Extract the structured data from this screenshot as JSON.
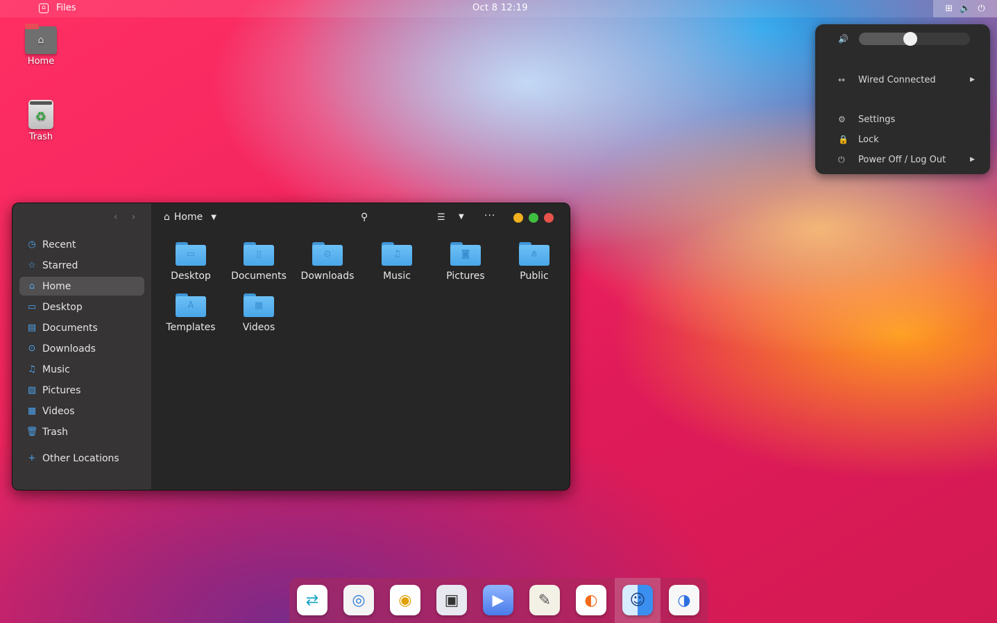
{
  "topbar": {
    "app_name": "Files",
    "clock": "Oct 8  12:19",
    "status_icons": [
      "network-icon",
      "volume-icon",
      "power-icon"
    ]
  },
  "desktop": {
    "icons": [
      {
        "label": "Home",
        "icon": "home-folder-icon"
      },
      {
        "label": "Trash",
        "icon": "trash-icon"
      }
    ]
  },
  "system_menu": {
    "volume_level": 0.46,
    "items": [
      {
        "label": "Wired Connected",
        "icon": "wired-icon",
        "has_submenu": true
      },
      {
        "label": "Settings",
        "icon": "settings-icon",
        "has_submenu": false
      },
      {
        "label": "Lock",
        "icon": "lock-icon",
        "has_submenu": false
      },
      {
        "label": "Power Off / Log Out",
        "icon": "power-icon",
        "has_submenu": true
      }
    ]
  },
  "files_window": {
    "location": "Home",
    "sidebar": [
      {
        "label": "Recent",
        "icon": "clock-icon"
      },
      {
        "label": "Starred",
        "icon": "star-icon"
      },
      {
        "label": "Home",
        "icon": "home-icon",
        "active": true
      },
      {
        "label": "Desktop",
        "icon": "desktop-icon"
      },
      {
        "label": "Documents",
        "icon": "documents-icon"
      },
      {
        "label": "Downloads",
        "icon": "downloads-icon"
      },
      {
        "label": "Music",
        "icon": "music-icon"
      },
      {
        "label": "Pictures",
        "icon": "pictures-icon"
      },
      {
        "label": "Videos",
        "icon": "videos-icon"
      },
      {
        "label": "Trash",
        "icon": "trash-icon"
      },
      {
        "label": "Other Locations",
        "icon": "plus-icon"
      }
    ],
    "folders": [
      {
        "label": "Desktop",
        "icon": "desktop-folder-icon"
      },
      {
        "label": "Documents",
        "icon": "documents-folder-icon"
      },
      {
        "label": "Downloads",
        "icon": "downloads-folder-icon"
      },
      {
        "label": "Music",
        "icon": "music-folder-icon"
      },
      {
        "label": "Pictures",
        "icon": "pictures-folder-icon"
      },
      {
        "label": "Public",
        "icon": "public-folder-icon"
      },
      {
        "label": "Templates",
        "icon": "templates-folder-icon"
      },
      {
        "label": "Videos",
        "icon": "videos-folder-icon"
      }
    ],
    "window_buttons": {
      "minimize": "#f2b01f",
      "maximize": "#3fbf3f",
      "close": "#e5534b"
    }
  },
  "dock": {
    "apps": [
      {
        "icon": "teamviewer-icon"
      },
      {
        "icon": "browser-icon"
      },
      {
        "icon": "rhythmbox-icon"
      },
      {
        "icon": "screenshot-icon"
      },
      {
        "icon": "video-call-icon"
      },
      {
        "icon": "text-editor-icon"
      },
      {
        "icon": "firefox-icon"
      },
      {
        "icon": "finder-icon",
        "active": true
      },
      {
        "icon": "settings-toggle-icon"
      }
    ]
  }
}
